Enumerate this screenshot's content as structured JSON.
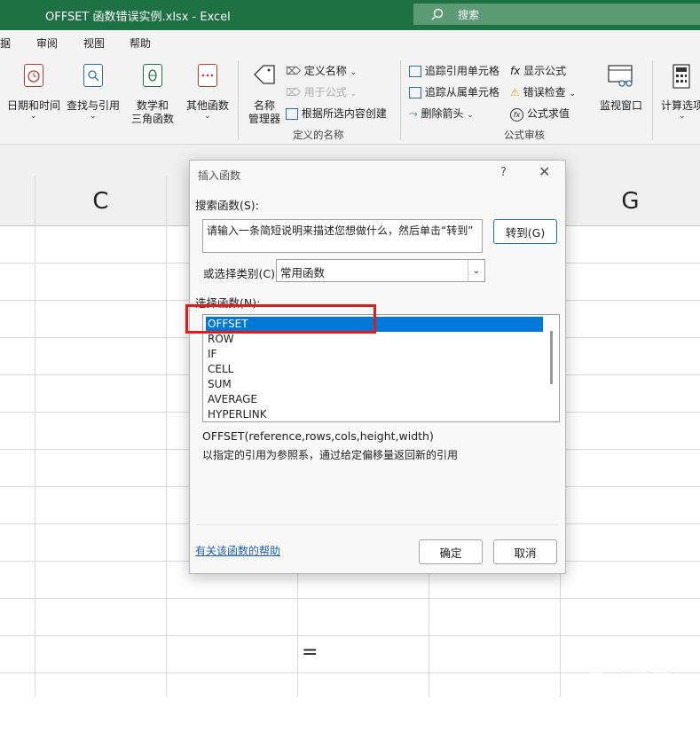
{
  "window": {
    "title": "OFFSET 函数错误实例.xlsx  -  Excel",
    "search_placeholder": "搜索"
  },
  "menu": [
    "据",
    "审阅",
    "视图",
    "帮助"
  ],
  "ribbon": {
    "buttons": [
      {
        "label": "日期和时间",
        "icon": "calendar-clock-icon"
      },
      {
        "label": "查找与引用",
        "icon": "lookup-icon"
      },
      {
        "label": "数学和",
        "label2": "三角函数",
        "icon": "math-theta-icon"
      },
      {
        "label": "其他函数",
        "icon": "more-functions-icon"
      }
    ],
    "names_group": {
      "manager_label1": "名称",
      "manager_label2": "管理器",
      "define_name": "定义名称",
      "use_in_formula": "用于公式",
      "create_from_selection": "根据所选内容创建",
      "group_label": "定义的名称"
    },
    "audit_group": {
      "trace_precedents": "追踪引用单元格",
      "trace_dependents": "追踪从属单元格",
      "remove_arrows": "删除箭头",
      "show_formulas": "显示公式",
      "error_checking": "错误检查",
      "evaluate_formula": "公式求值",
      "watch_window": "监视窗口",
      "group_label": "公式审核"
    },
    "calc_options": "计算选项"
  },
  "grid": {
    "col_c": "C",
    "col_g": "G",
    "cell_text": "="
  },
  "dialog": {
    "title": "插入函数",
    "help": "?",
    "close": "✕",
    "search_label": "搜索函数(S):",
    "search_text": "请输入一条简短说明来描述您想做什么，然后单击“转到”",
    "goto_button": "转到(G)",
    "category_label": "或选择类别(C):",
    "category_value": "常用函数",
    "functions_label": "选择函数(N):",
    "functions": [
      "OFFSET",
      "ROW",
      "IF",
      "CELL",
      "SUM",
      "AVERAGE",
      "HYPERLINK"
    ],
    "selected_function": "OFFSET",
    "signature": "OFFSET(reference,rows,cols,height,width)",
    "description": "以指定的引用为参照系，通过给定偏移量返回新的引用",
    "help_link": "有关该函数的帮助",
    "ok_button": "确定",
    "cancel_button": "取消"
  },
  "watermark": {
    "text": "路由器",
    "sub": "luyouqi.com"
  },
  "colors": {
    "excel_green": "#1e7145",
    "selection_blue": "#0078d7",
    "highlight_red": "#e21a1a"
  }
}
